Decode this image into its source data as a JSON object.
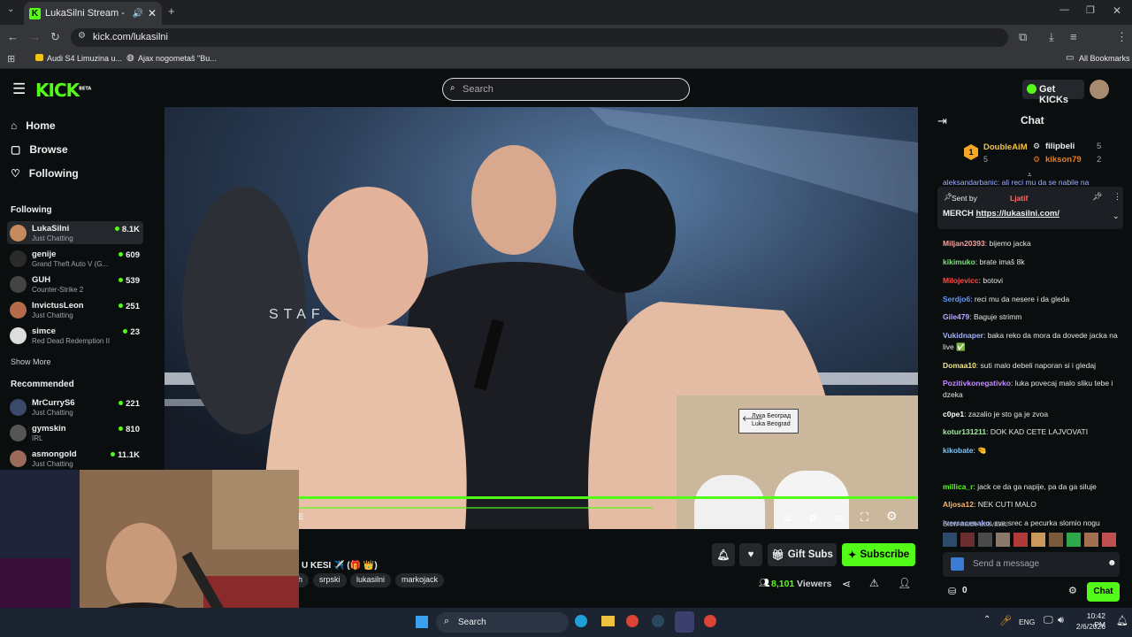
{
  "browser": {
    "tab_title": "LukaSilni Stream - Watch Li",
    "url": "kick.com/lukasilni",
    "bookmarks": [
      "Audi S4 Limuzina u...",
      "Ajax nogometaš \"Bu..."
    ],
    "all_bookmarks": "All Bookmarks"
  },
  "header": {
    "logo": "KICK",
    "logo_badge": "BETA",
    "search_placeholder": "Search",
    "get_kicks": "Get KICKs"
  },
  "sidebar": {
    "nav": [
      {
        "label": "Home",
        "icon": "home-icon"
      },
      {
        "label": "Browse",
        "icon": "browse-icon"
      },
      {
        "label": "Following",
        "icon": "heart-icon"
      }
    ],
    "following_title": "Following",
    "following": [
      {
        "name": "LukaSilni",
        "sub": "Just Chatting",
        "viewers": "8.1K"
      },
      {
        "name": "genije",
        "sub": "Grand Theft Auto V (G...",
        "viewers": "609"
      },
      {
        "name": "GUH",
        "sub": "Counter-Strike 2",
        "viewers": "539"
      },
      {
        "name": "InvictusLeon",
        "sub": "Just Chatting",
        "viewers": "251"
      },
      {
        "name": "simce",
        "sub": "Red Dead Redemption II",
        "viewers": "23"
      }
    ],
    "show_more": "Show More",
    "recommended_title": "Recommended",
    "recommended": [
      {
        "name": "MrCurryS6",
        "sub": "Just Chatting",
        "viewers": "221"
      },
      {
        "name": "gymskin",
        "sub": "IRL",
        "viewers": "810"
      },
      {
        "name": "asmongold",
        "sub": "Just Chatting",
        "viewers": "11.1K"
      }
    ]
  },
  "video": {
    "overlay_text": "STAF",
    "sign_text_1": "Лука Београд",
    "sign_text_2": "Luka Beograd",
    "caption_text": "E"
  },
  "stream": {
    "title": "U KESI ✈️ (🎁 👑)",
    "tags": [
      "h",
      "srpski",
      "lukasilni",
      "markojack"
    ],
    "gift_subs": "Gift Subs",
    "subscribe": "Subscribe",
    "viewers": "8,101",
    "viewers_label": "Viewers"
  },
  "chat": {
    "title": "Chat",
    "leaderboard": [
      {
        "rank": "1",
        "name": "DoubleAiM",
        "count": "5"
      },
      {
        "name": "filipbeli",
        "count": "5"
      },
      {
        "name": "kikson79",
        "count": "2"
      }
    ],
    "cut_line": "aleksandarbanic: ali reci mu da se nabile na",
    "pinned": {
      "sent_by": "Sent by",
      "sender": "Ljatif",
      "text": "MERCH ",
      "link": "https://lukasilni.com/"
    },
    "messages": [
      {
        "user": "Miljan20393",
        "color": "#f5a3a3",
        "text": "bijemo jacka"
      },
      {
        "user": "kikimuko",
        "color": "#7de37d",
        "text": "brate imaš 8k"
      },
      {
        "user": "Milojevicc",
        "color": "#ff4a4a",
        "text": "botovi"
      },
      {
        "user": "Serdjo6",
        "color": "#5b9bff",
        "text": "reci mu da nesere i da gleda"
      },
      {
        "user": "Gile479",
        "color": "#b9a6ff",
        "text": "Baguje strimm"
      },
      {
        "user": "Vukidnaper",
        "color": "#9db1ff",
        "text": "baka reko da mora da dovede jacka na live ✅"
      },
      {
        "user": "Domaa10",
        "color": "#f0e68c",
        "text": "suti malo debeli naporan si i gledaj"
      },
      {
        "user": "Pozitivkonegativko",
        "color": "#c28bff",
        "text": "luka povecaj malo sliku tebe i dzeka"
      },
      {
        "user": "c0pe1",
        "color": "#ffffff",
        "text": "zazalio je sto ga je zvoa"
      },
      {
        "user": "kotur131211",
        "color": "#9ef09e",
        "text": "DOK KAD CETE LAJVOVATI"
      },
      {
        "user": "kikobate",
        "color": "#7ec8ff",
        "text": "🤏"
      },
      {
        "user": "millica_r",
        "color": "#53fc18",
        "text": "jack ce da ga napije, pa da ga siluje"
      },
      {
        "user": "Aljosa12",
        "color": "#ffb36b",
        "text": "NEK CUTI MALO"
      },
      {
        "user": "iversacesako",
        "color": "#9db1ff",
        "text": "sva srec a pecurka slomio nogu"
      }
    ],
    "slow_mode": "Slow mode activated",
    "input_placeholder": "Send a message",
    "kicks_count": "0",
    "send_label": "Chat"
  },
  "taskbar": {
    "search": "Search",
    "lang": "ENG",
    "time": "10:42 PM",
    "date": "2/6/2026"
  }
}
